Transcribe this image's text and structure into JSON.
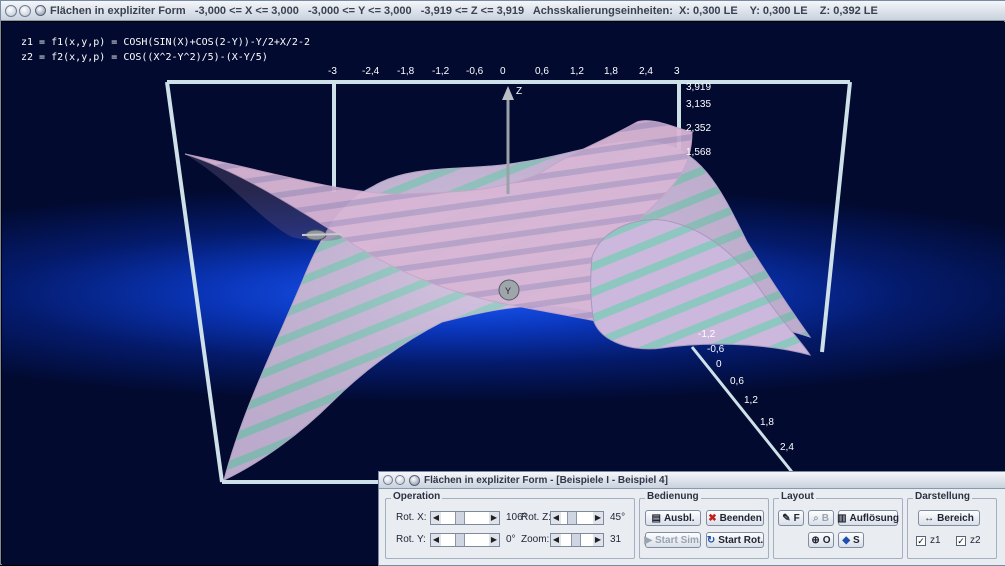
{
  "main_window": {
    "title": "Flächen in expliziter Form   -3,000 <= X <= 3,000   -3,000 <= Y <= 3,000   -3,919 <= Z <= 3,919   Achsskalierungseinheiten:  X: 0,300 LE    Y: 0,300 LE    Z: 0,392 LE"
  },
  "formulas": {
    "z1": "z1 = f1(x,y,p) = COSH(SIN(X)+COS(2-Y))-Y/2+X/2-2",
    "z2": "z2 = f2(x,y,p) = COS((X^2-Y^2)/5)-(X-Y/5)"
  },
  "axes": {
    "x_ticks": [
      "-3",
      "-2,4",
      "-1,8",
      "-1,2",
      "-0,6",
      "0",
      "0,6",
      "1,2",
      "1,8",
      "2,4",
      "3"
    ],
    "z_ticks": [
      "3,919",
      "3,135",
      "2,352",
      "1,568"
    ],
    "y_ticks": [
      "-1,2",
      "-0,6",
      "0",
      "0,6",
      "1,2",
      "1,8",
      "2,4"
    ],
    "z_axis_label": "Z",
    "y_axis_label": "Y",
    "colors": {
      "frame": "#c9dde6",
      "stripe_a": "#c9b7d9",
      "stripe_b": "#8fc4c0",
      "sheet": "#d7b5d6"
    }
  },
  "dialog": {
    "title": "Flächen in expliziter Form - [Beispiele I - Beispiel 4]",
    "operation": {
      "title": "Operation",
      "rot_x_label": "Rot. X:",
      "rot_x_value": "106°",
      "rot_y_label": "Rot. Y:",
      "rot_y_value": "0°",
      "rot_z_label": "Rot. Z:",
      "rot_z_value": "45°",
      "zoom_label": "Zoom:",
      "zoom_value": "31"
    },
    "bedienung": {
      "title": "Bedienung",
      "ausbl": "Ausbl.",
      "beenden": "Beenden",
      "start_sim": "Start Sim.",
      "start_rot": "Start Rot."
    },
    "layout": {
      "title": "Layout",
      "f_label": "F",
      "b_label": "B",
      "aufloesung": "Auflösung",
      "o_label": "O",
      "s_label": "S"
    },
    "darstellung": {
      "title": "Darstellung",
      "bereich": "Bereich",
      "z1_label": "z1",
      "z1_checked": true,
      "z2_label": "z2",
      "z2_checked": true
    }
  }
}
